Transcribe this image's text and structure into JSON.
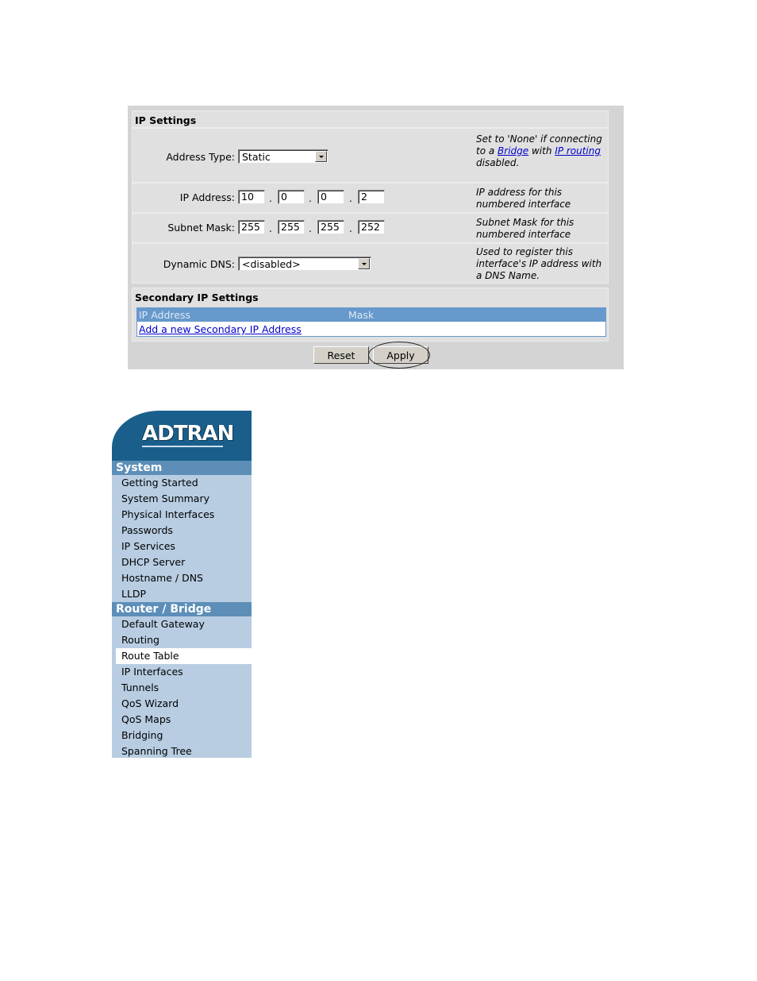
{
  "ip_settings": {
    "title": "IP Settings",
    "address_type": {
      "label": "Address Type:",
      "value": "Static",
      "help_pre": "Set to 'None' if connecting to a ",
      "help_link1": "Bridge",
      "help_mid": " with ",
      "help_link2": "IP routing",
      "help_post": " disabled."
    },
    "ip_address": {
      "label": "IP Address:",
      "octets": [
        "10",
        "0",
        "0",
        "2"
      ],
      "help": "IP address for this numbered interface"
    },
    "subnet_mask": {
      "label": "Subnet Mask:",
      "octets": [
        "255",
        "255",
        "255",
        "252"
      ],
      "help": "Subnet Mask for this numbered interface"
    },
    "dynamic_dns": {
      "label": "Dynamic DNS:",
      "value": "<disabled>",
      "help": "Used to register this interface's IP address with a DNS Name."
    },
    "dot": "."
  },
  "secondary_ip": {
    "title": "Secondary IP Settings",
    "columns": [
      "IP Address",
      "Mask"
    ],
    "add_link": "Add a new Secondary IP Address"
  },
  "buttons": {
    "reset": "Reset",
    "apply": "Apply"
  },
  "sidebar": {
    "logo": "ADTRAN",
    "sections": [
      {
        "header": "System",
        "items": [
          "Getting Started",
          "System Summary",
          "Physical Interfaces",
          "Passwords",
          "IP Services",
          "DHCP Server",
          "Hostname / DNS",
          "LLDP"
        ]
      },
      {
        "header": "Router / Bridge",
        "items": [
          "Default Gateway",
          "Routing",
          "Route Table",
          "IP Interfaces",
          "Tunnels",
          "QoS Wizard",
          "QoS Maps",
          "Bridging",
          "Spanning Tree"
        ]
      }
    ],
    "selected_item": "Route Table"
  },
  "colors": {
    "panel_bg": "#d4d4d4",
    "section_bg": "#e0e0e0",
    "table_header": "#6699cc",
    "nav_header": "#5c8eb8",
    "nav_bg": "#b8cde2",
    "logo_bg": "#1a5f8c",
    "link": "#0000cc"
  }
}
